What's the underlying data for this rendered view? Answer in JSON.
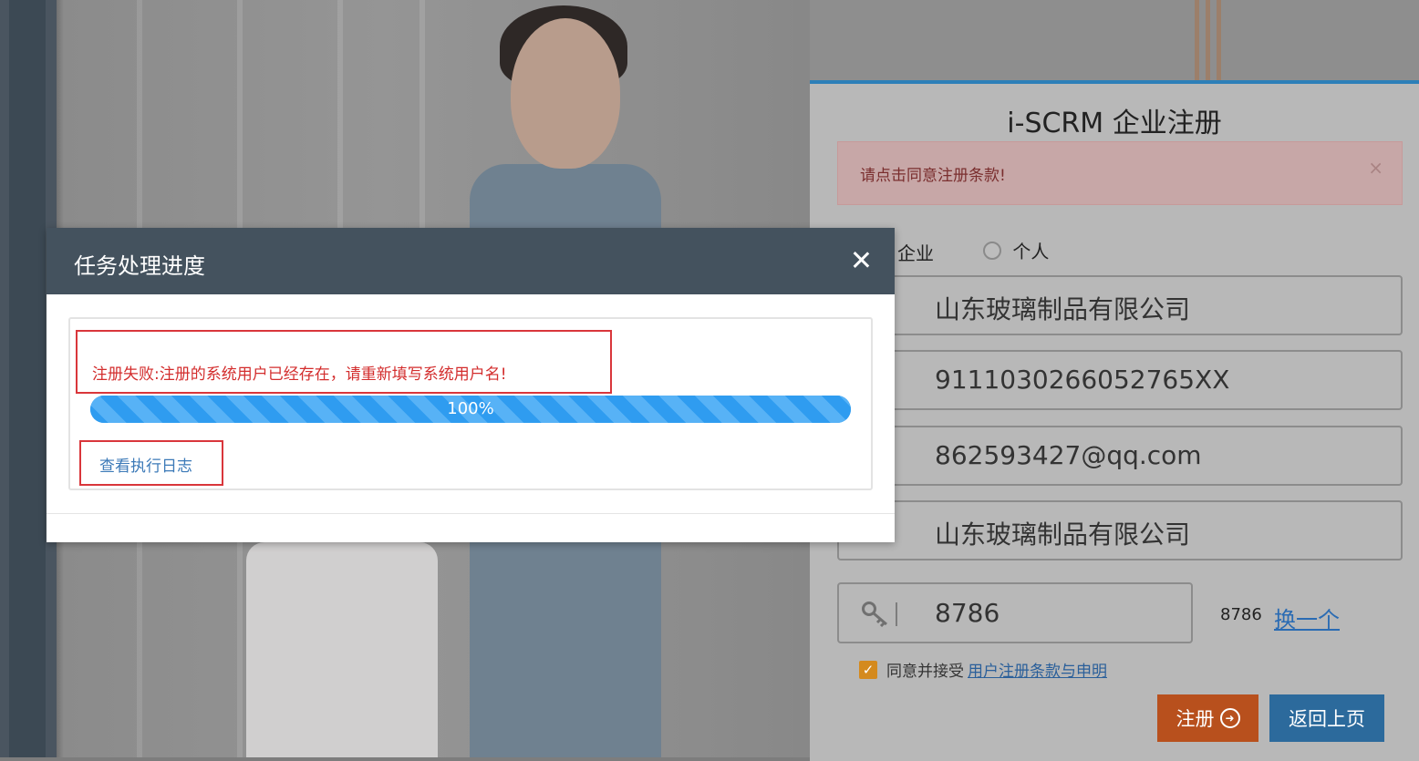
{
  "registration": {
    "title": "i-SCRM 企业注册",
    "alert_message": "请点击同意注册条款!",
    "alert_close": "×",
    "account_types": [
      "企业",
      "个人"
    ],
    "fields": {
      "company_name": "山东玻璃制品有限公司",
      "credit_code": "9111030266052765XX",
      "email": "862593427@qq.com",
      "username": "山东玻璃制品有限公司"
    },
    "captcha_value": "8786",
    "captcha_code": "8786",
    "captcha_refresh": "换一个",
    "agree_label": "同意并接受",
    "agree_link": "用户注册条款与申明",
    "agree_checked": true,
    "register_button": "注册",
    "back_button": "返回上页"
  },
  "modal": {
    "title": "任务处理进度",
    "error_message": "注册失败:注册的系统用户已经存在，请重新填写系统用户名!",
    "progress_percent": 100,
    "progress_label": "100%",
    "view_log_link": "查看执行日志"
  },
  "colors": {
    "modal_header": "#44525e",
    "progress_bar": "#2f9cf0",
    "error_text": "#d32d2d",
    "register_button": "#b8501d",
    "back_button": "#2c6a9c",
    "accent_border": "#2d7fb8"
  }
}
